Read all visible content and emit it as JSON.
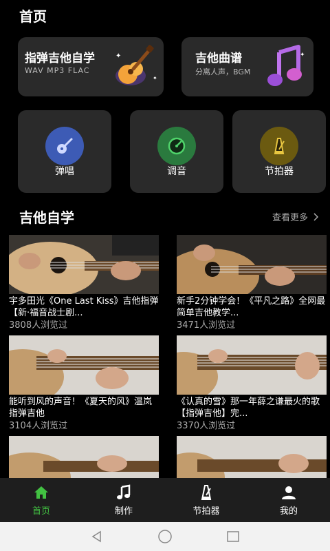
{
  "header": {
    "title": "首页"
  },
  "features": [
    {
      "title": "指弹吉他自学",
      "subtitle": "WAV  MP3  FLAC",
      "icon": "guitar-icon"
    },
    {
      "title": "吉他曲谱",
      "subtitle": "分离人声，BGM",
      "icon": "music-note-icon"
    }
  ],
  "tools": [
    {
      "label": "弹唱",
      "icon": "guitar-icon",
      "color": "#3d5bb5"
    },
    {
      "label": "调音",
      "icon": "tuner-gauge-icon",
      "color": "#2a7a3e"
    },
    {
      "label": "节拍器",
      "icon": "metronome-icon",
      "color": "#6b5a10"
    }
  ],
  "section": {
    "title": "吉他自学",
    "more": "查看更多"
  },
  "videos": [
    {
      "title": "宇多田光《One Last Kiss》吉他指弹【新·福音战士剧...",
      "views": "3808人浏览过"
    },
    {
      "title": "新手2分钟学会！《平凡之路》全网最简单吉他教学...",
      "views": "3471人浏览过"
    },
    {
      "title": "能听到风的声音！《夏天的风》温岚 指弹吉他",
      "views": "3104人浏览过"
    },
    {
      "title": "《认真的雪》那一年薛之谦最火的歌【指弹吉他】完...",
      "views": "3370人浏览过"
    },
    {
      "title": "",
      "views": ""
    },
    {
      "title": "",
      "views": ""
    }
  ],
  "tabs": [
    {
      "label": "首页",
      "icon": "home-icon",
      "active": true
    },
    {
      "label": "制作",
      "icon": "music-note-icon",
      "active": false
    },
    {
      "label": "节拍器",
      "icon": "metronome-icon",
      "active": false
    },
    {
      "label": "我的",
      "icon": "user-icon",
      "active": false
    }
  ],
  "colors": {
    "accent": "#42c142",
    "card": "#2a2a2a",
    "background": "#000000"
  }
}
